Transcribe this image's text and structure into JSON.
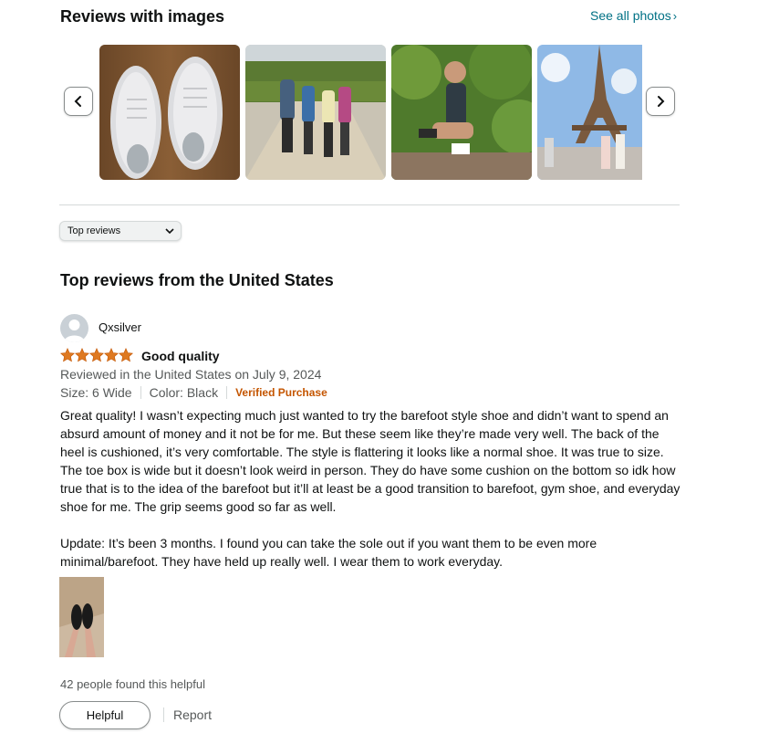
{
  "images_section": {
    "title": "Reviews with images",
    "see_all_label": "See all photos",
    "prev_icon": "chevron-left-icon",
    "next_icon": "chevron-right-icon",
    "thumbnails": [
      {
        "subject": "white knit sneakers on a wooden floor"
      },
      {
        "subject": "family hiking on a vineyard trail"
      },
      {
        "subject": "woman crouching in a vineyard"
      },
      {
        "subject": "tourists near the Eiffel Tower"
      }
    ]
  },
  "sort": {
    "selected": "Top reviews"
  },
  "reviews_heading": "Top reviews from the United States",
  "review": {
    "author": "Qxsilver",
    "rating": 5,
    "rating_max": 5,
    "title": "Good quality",
    "date_line": "Reviewed in the United States on July 9, 2024",
    "size": "Size: 6 Wide",
    "color": "Color: Black",
    "verified": "Verified Purchase",
    "body": "Great quality! I wasn’t expecting much just wanted to try the barefoot style shoe and didn’t want to spend an absurd amount of money and it not be for me. But these seem like they’re made very well. The back of the heel is cushioned, it’s very comfortable. The style is flattering it looks like a normal shoe. It was true to size. The toe box is wide but it doesn’t look weird in person. They do have some cushion on the bottom so idk how true that is to the idea of the barefoot but it’ll at least be a good transition to barefoot, gym shoe, and everyday shoe for me. The grip seems good so far as well.",
    "update": "Update: It’s been 3 months. I found you can take the sole out if you want them to be even more minimal/barefoot. They have held up really well. I wear them to work everyday.",
    "helpful_count": "42 people found this helpful",
    "helpful_label": "Helpful",
    "report_label": "Report"
  },
  "colors": {
    "link": "#007185",
    "star": "#de7921",
    "verified": "#c45500",
    "muted_text": "#565959"
  }
}
